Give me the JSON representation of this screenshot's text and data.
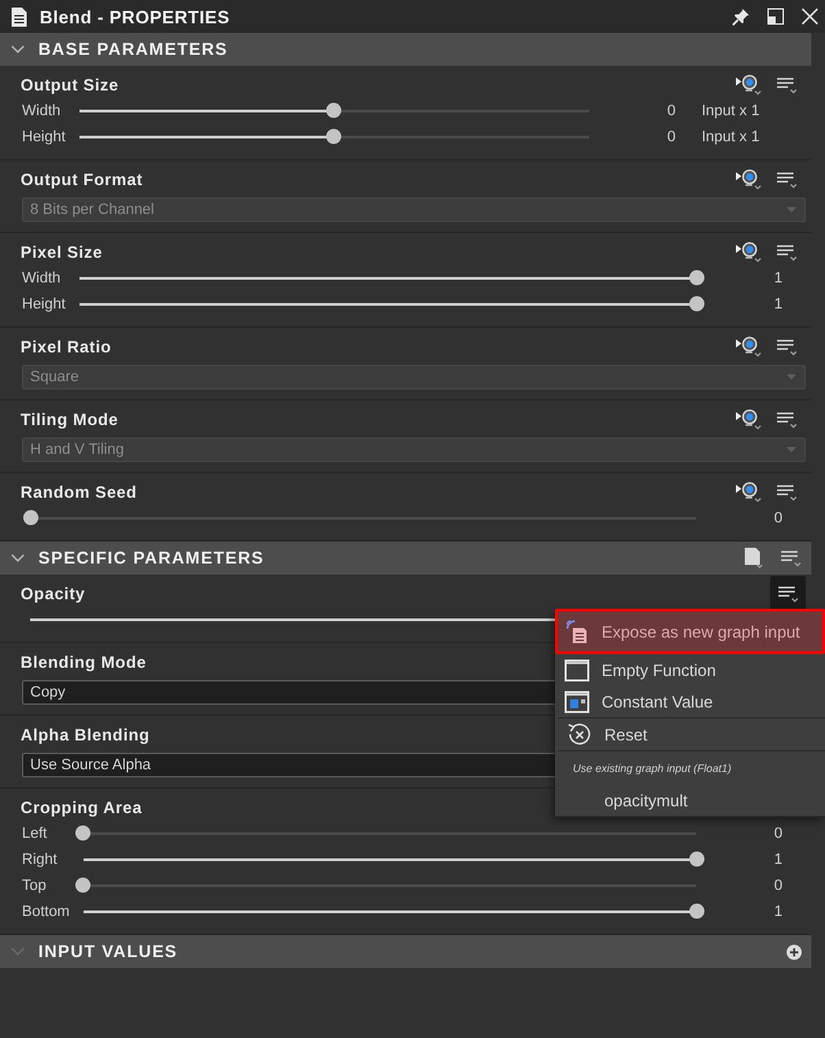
{
  "window": {
    "title": "Blend - PROPERTIES"
  },
  "sections": [
    {
      "title": "BASE PARAMETERS",
      "params": [
        {
          "name": "Output Size",
          "kind": "slider",
          "buttons": [
            {
              "kind": "expose",
              "pressed": false
            },
            {
              "kind": "menu",
              "pressed": false
            }
          ],
          "rows": [
            {
              "label": "Width",
              "level": 0.5,
              "value": "0",
              "suffix": "Input x 1"
            },
            {
              "label": "Height",
              "level": 0.5,
              "value": "0",
              "suffix": "Input x 1"
            }
          ]
        },
        {
          "name": "Output Format",
          "kind": "dropdown",
          "buttons": [
            {
              "kind": "expose",
              "pressed": false
            },
            {
              "kind": "menu",
              "pressed": false
            }
          ],
          "value": "8 Bits per Channel",
          "disabled": true
        },
        {
          "name": "Pixel Size",
          "kind": "slider",
          "buttons": [
            {
              "kind": "expose",
              "pressed": false
            },
            {
              "kind": "menu",
              "pressed": false
            }
          ],
          "rows": [
            {
              "label": "Width",
              "level": 1,
              "value": "1"
            },
            {
              "label": "Height",
              "level": 1,
              "value": "1"
            }
          ]
        },
        {
          "name": "Pixel Ratio",
          "kind": "dropdown",
          "buttons": [
            {
              "kind": "expose",
              "pressed": false
            },
            {
              "kind": "menu",
              "pressed": false
            }
          ],
          "value": "Square",
          "disabled": true
        },
        {
          "name": "Tiling Mode",
          "kind": "dropdown",
          "buttons": [
            {
              "kind": "expose",
              "pressed": false
            },
            {
              "kind": "menu",
              "pressed": false
            }
          ],
          "value": "H and V Tiling",
          "disabled": true
        },
        {
          "name": "Random Seed",
          "kind": "slider",
          "buttons": [
            {
              "kind": "expose",
              "pressed": false
            },
            {
              "kind": "menu",
              "pressed": false
            }
          ],
          "rows": [
            {
              "level": 0,
              "value": "0"
            }
          ]
        }
      ]
    },
    {
      "title": "SPECIFIC PARAMETERS",
      "buttons": [
        {
          "kind": "preset",
          "pressed": false
        },
        {
          "kind": "menu",
          "pressed": false
        }
      ],
      "params": [
        {
          "name": "Opacity",
          "kind": "slider",
          "buttons": [
            {
              "kind": "menu",
              "pressed": true
            }
          ],
          "rows": [
            {
              "level": 1
            }
          ]
        },
        {
          "name": "Blending Mode",
          "kind": "dropdown",
          "value": "Copy",
          "disabled": false
        },
        {
          "name": "Alpha Blending",
          "kind": "dropdown",
          "value": "Use Source Alpha",
          "disabled": false
        },
        {
          "name": "Cropping Area",
          "kind": "slider",
          "rows": [
            {
              "label": "Left",
              "level": 0,
              "value": "0"
            },
            {
              "label": "Right",
              "level": 1,
              "value": "1"
            },
            {
              "label": "Top",
              "level": 0,
              "value": "0"
            },
            {
              "label": "Bottom",
              "level": 1,
              "value": "1"
            }
          ]
        }
      ]
    },
    {
      "title": "INPUT VALUES",
      "buttons": [
        {
          "kind": "add",
          "pressed": false
        }
      ]
    }
  ],
  "context_menu": {
    "groups": [
      {
        "items": [
          {
            "kind": "expose",
            "label": "Expose as new graph input",
            "selected": true
          },
          {
            "kind": "function",
            "label": "Empty Function",
            "selected": false
          },
          {
            "kind": "constant",
            "label": "Constant Value",
            "selected": false
          }
        ]
      },
      {
        "items": [
          {
            "kind": "reset",
            "label": "Reset",
            "selected": false
          }
        ]
      },
      {
        "caption": "Use existing graph input (Float1)",
        "items": [
          {
            "kind": "input",
            "label": "opacitymult",
            "selected": false
          }
        ]
      }
    ]
  }
}
